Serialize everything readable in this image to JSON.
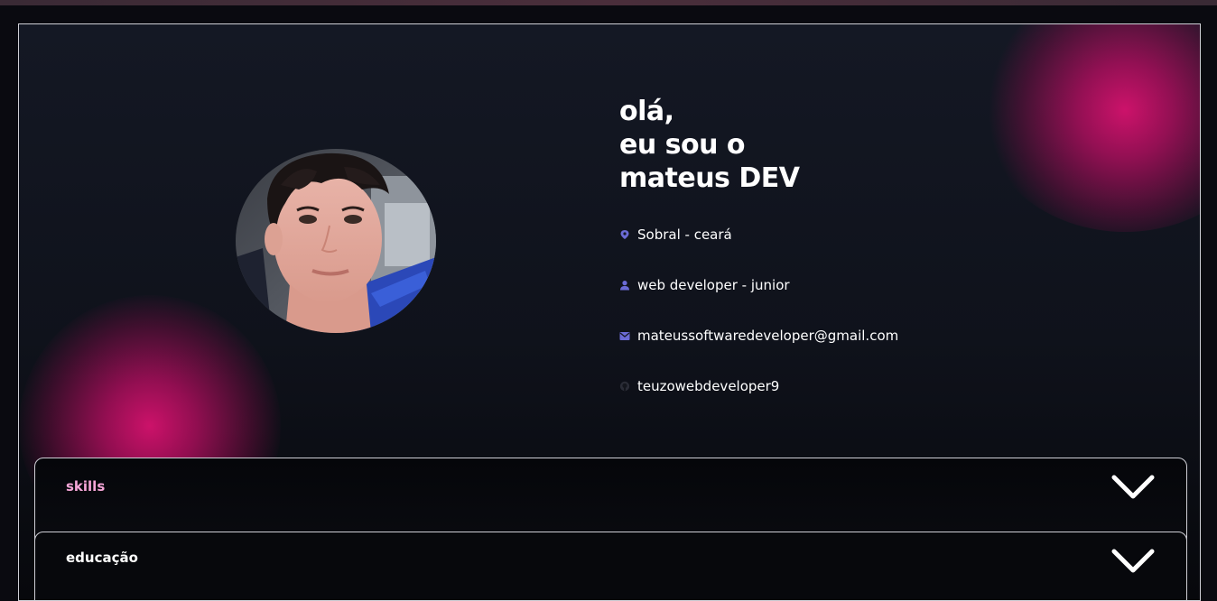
{
  "intro": {
    "line1": "olá,",
    "line2": "eu sou o",
    "line3": "mateus DEV"
  },
  "info": {
    "location": "Sobral - ceará",
    "role": "web developer - junior",
    "email": "mateussoftwaredeveloper@gmail.com",
    "github": "teuzowebdeveloper9"
  },
  "icons": {
    "location": "location-pin-icon",
    "role": "user-icon",
    "email": "mail-icon",
    "github": "github-icon"
  },
  "sections": {
    "skills_label": "skills",
    "education_label": "educação"
  },
  "colors": {
    "accent_glow": "#d6126e",
    "icon_color": "#6b6bd6",
    "skills_label": "#f5a6d8",
    "border": "#cfcfd6"
  }
}
